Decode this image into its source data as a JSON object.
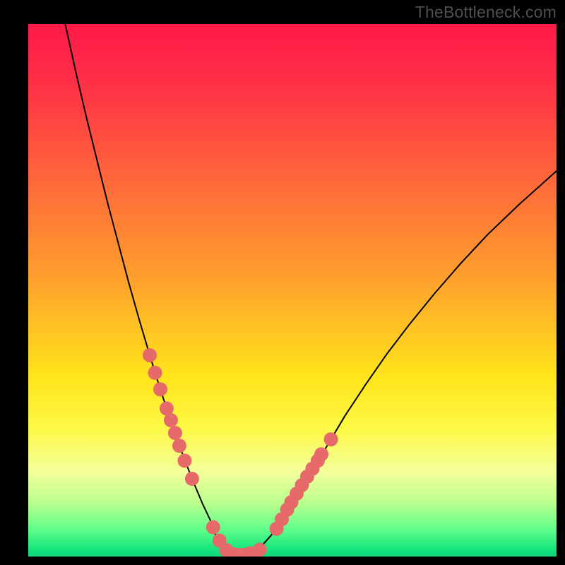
{
  "watermark": "TheBottleneck.com",
  "chart_data": {
    "type": "line",
    "title": "",
    "xlabel": "",
    "ylabel": "",
    "xlim": [
      0,
      1
    ],
    "ylim": [
      0,
      1
    ],
    "background_gradient": {
      "stops": [
        {
          "offset": 0.0,
          "color": "#ff1a49"
        },
        {
          "offset": 0.12,
          "color": "#ff3246"
        },
        {
          "offset": 0.3,
          "color": "#ff6a3a"
        },
        {
          "offset": 0.48,
          "color": "#ffa12d"
        },
        {
          "offset": 0.66,
          "color": "#ffe41a"
        },
        {
          "offset": 0.76,
          "color": "#fdf946"
        },
        {
          "offset": 0.84,
          "color": "#f4ff9a"
        },
        {
          "offset": 0.9,
          "color": "#b9ff8e"
        },
        {
          "offset": 0.95,
          "color": "#5fff8a"
        },
        {
          "offset": 0.985,
          "color": "#17e67c"
        },
        {
          "offset": 1.0,
          "color": "#0ed47a"
        }
      ]
    },
    "series": [
      {
        "name": "curve",
        "stroke": "#000000",
        "stroke_width": 2,
        "x": [
          0.07,
          0.09,
          0.11,
          0.13,
          0.15,
          0.17,
          0.19,
          0.21,
          0.23,
          0.25,
          0.27,
          0.29,
          0.31,
          0.33,
          0.35,
          0.355,
          0.36,
          0.38,
          0.4,
          0.42,
          0.44,
          0.46,
          0.48,
          0.51,
          0.54,
          0.57,
          0.6,
          0.64,
          0.68,
          0.72,
          0.77,
          0.82,
          0.87,
          0.93,
          1.0
        ],
        "y": [
          1.0,
          0.91,
          0.825,
          0.745,
          0.665,
          0.59,
          0.515,
          0.445,
          0.378,
          0.314,
          0.254,
          0.198,
          0.146,
          0.099,
          0.057,
          0.038,
          0.025,
          0.01,
          0.004,
          0.006,
          0.018,
          0.04,
          0.07,
          0.115,
          0.165,
          0.215,
          0.265,
          0.325,
          0.382,
          0.434,
          0.495,
          0.552,
          0.605,
          0.662,
          0.724
        ]
      }
    ],
    "markers": {
      "name": "highlight-dots",
      "color": "#e66a6a",
      "radius": 10,
      "points": [
        {
          "x": 0.23,
          "y": 0.378
        },
        {
          "x": 0.24,
          "y": 0.345
        },
        {
          "x": 0.25,
          "y": 0.314
        },
        {
          "x": 0.262,
          "y": 0.278
        },
        {
          "x": 0.27,
          "y": 0.256
        },
        {
          "x": 0.278,
          "y": 0.232
        },
        {
          "x": 0.286,
          "y": 0.208
        },
        {
          "x": 0.296,
          "y": 0.18
        },
        {
          "x": 0.31,
          "y": 0.146
        },
        {
          "x": 0.35,
          "y": 0.055
        },
        {
          "x": 0.362,
          "y": 0.03
        },
        {
          "x": 0.375,
          "y": 0.012
        },
        {
          "x": 0.39,
          "y": 0.004
        },
        {
          "x": 0.405,
          "y": 0.003
        },
        {
          "x": 0.42,
          "y": 0.006
        },
        {
          "x": 0.438,
          "y": 0.013
        },
        {
          "x": 0.47,
          "y": 0.052
        },
        {
          "x": 0.48,
          "y": 0.07
        },
        {
          "x": 0.49,
          "y": 0.088
        },
        {
          "x": 0.498,
          "y": 0.102
        },
        {
          "x": 0.508,
          "y": 0.118
        },
        {
          "x": 0.518,
          "y": 0.134
        },
        {
          "x": 0.528,
          "y": 0.15
        },
        {
          "x": 0.538,
          "y": 0.165
        },
        {
          "x": 0.548,
          "y": 0.18
        },
        {
          "x": 0.555,
          "y": 0.192
        },
        {
          "x": 0.573,
          "y": 0.22
        }
      ]
    }
  }
}
